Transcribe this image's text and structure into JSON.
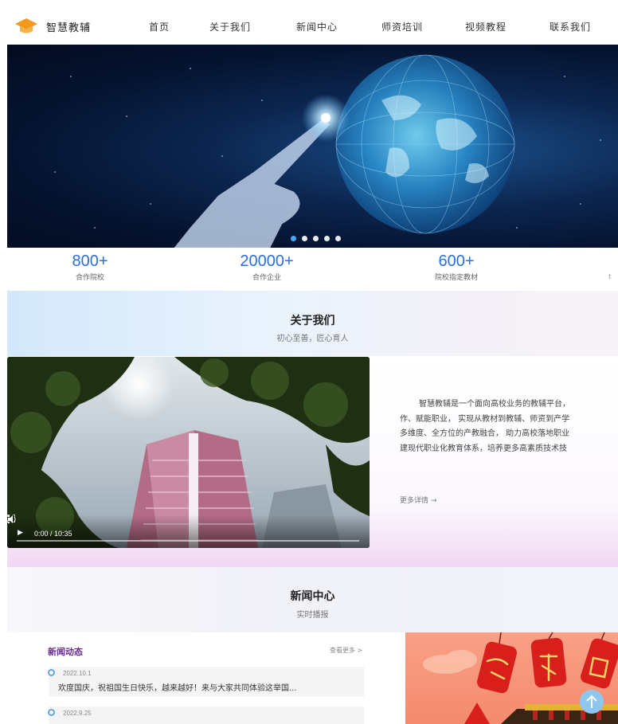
{
  "brand": {
    "name": "智慧教辅"
  },
  "nav": [
    {
      "label": "首页"
    },
    {
      "label": "关于我们"
    },
    {
      "label": "新闻中心"
    },
    {
      "label": "师资培训"
    },
    {
      "label": "视频教程"
    },
    {
      "label": "联系我们"
    }
  ],
  "carousel": {
    "slide_count": 5,
    "active_index": 0
  },
  "stats": [
    {
      "value": "800+",
      "label": "合作院校"
    },
    {
      "value": "20000+",
      "label": "合作企业"
    },
    {
      "value": "600+",
      "label": "院校指定教材"
    }
  ],
  "stats_edge_glyph": "t",
  "about": {
    "title": "关于我们",
    "subtitle": "初心至善，匠心育人",
    "paragraph_lines": [
      "智慧教辅是一个面向高校业务的教辅平台，",
      "作、赋能职业， 实现从教材到教辅、师资到产学",
      "多维度、全方位的产教融合， 助力高校落地职业",
      "建现代职业化教育体系，培养更多高素质技术技"
    ],
    "more_link": "更多详情 →",
    "video": {
      "time": "0:00 / 10:35",
      "progress": 0
    }
  },
  "news": {
    "title": "新闻中心",
    "subtitle": "实时播报",
    "block_title": "新闻动态",
    "more_link": "查看更多 >",
    "items": [
      {
        "date": "2022.10.1",
        "title": "欢度国庆，祝祖国生日快乐，越来越好！来与大家共同体验这举国..."
      },
      {
        "date": "2022.9.25",
        "title": ""
      }
    ]
  },
  "colors": {
    "accent_blue": "#2a6fe0",
    "news_purple": "#6a2b8f",
    "logo_orange": "#f39a1e"
  }
}
